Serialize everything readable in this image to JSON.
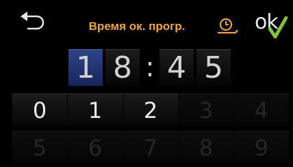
{
  "header": {
    "title": "Время ок. прогр.",
    "ok_label": "ok",
    "back_icon": "back-arrow-icon",
    "timer_icon": "delayed-end-timer-icon",
    "check_icon": "checkmark-icon"
  },
  "time": {
    "h1": "1",
    "h2": "8",
    "sep": ":",
    "m1": "4",
    "m2": "5",
    "active_digit": "h1"
  },
  "keypad": {
    "row1": [
      "0",
      "1",
      "2",
      "3",
      "4"
    ],
    "row2": [
      "5",
      "6",
      "7",
      "8",
      "9"
    ],
    "enabled": [
      "0",
      "1",
      "2"
    ]
  },
  "colors": {
    "title": "#f0a43a",
    "active_digit_bg": "#2d4488",
    "check": "#7fc43a"
  }
}
